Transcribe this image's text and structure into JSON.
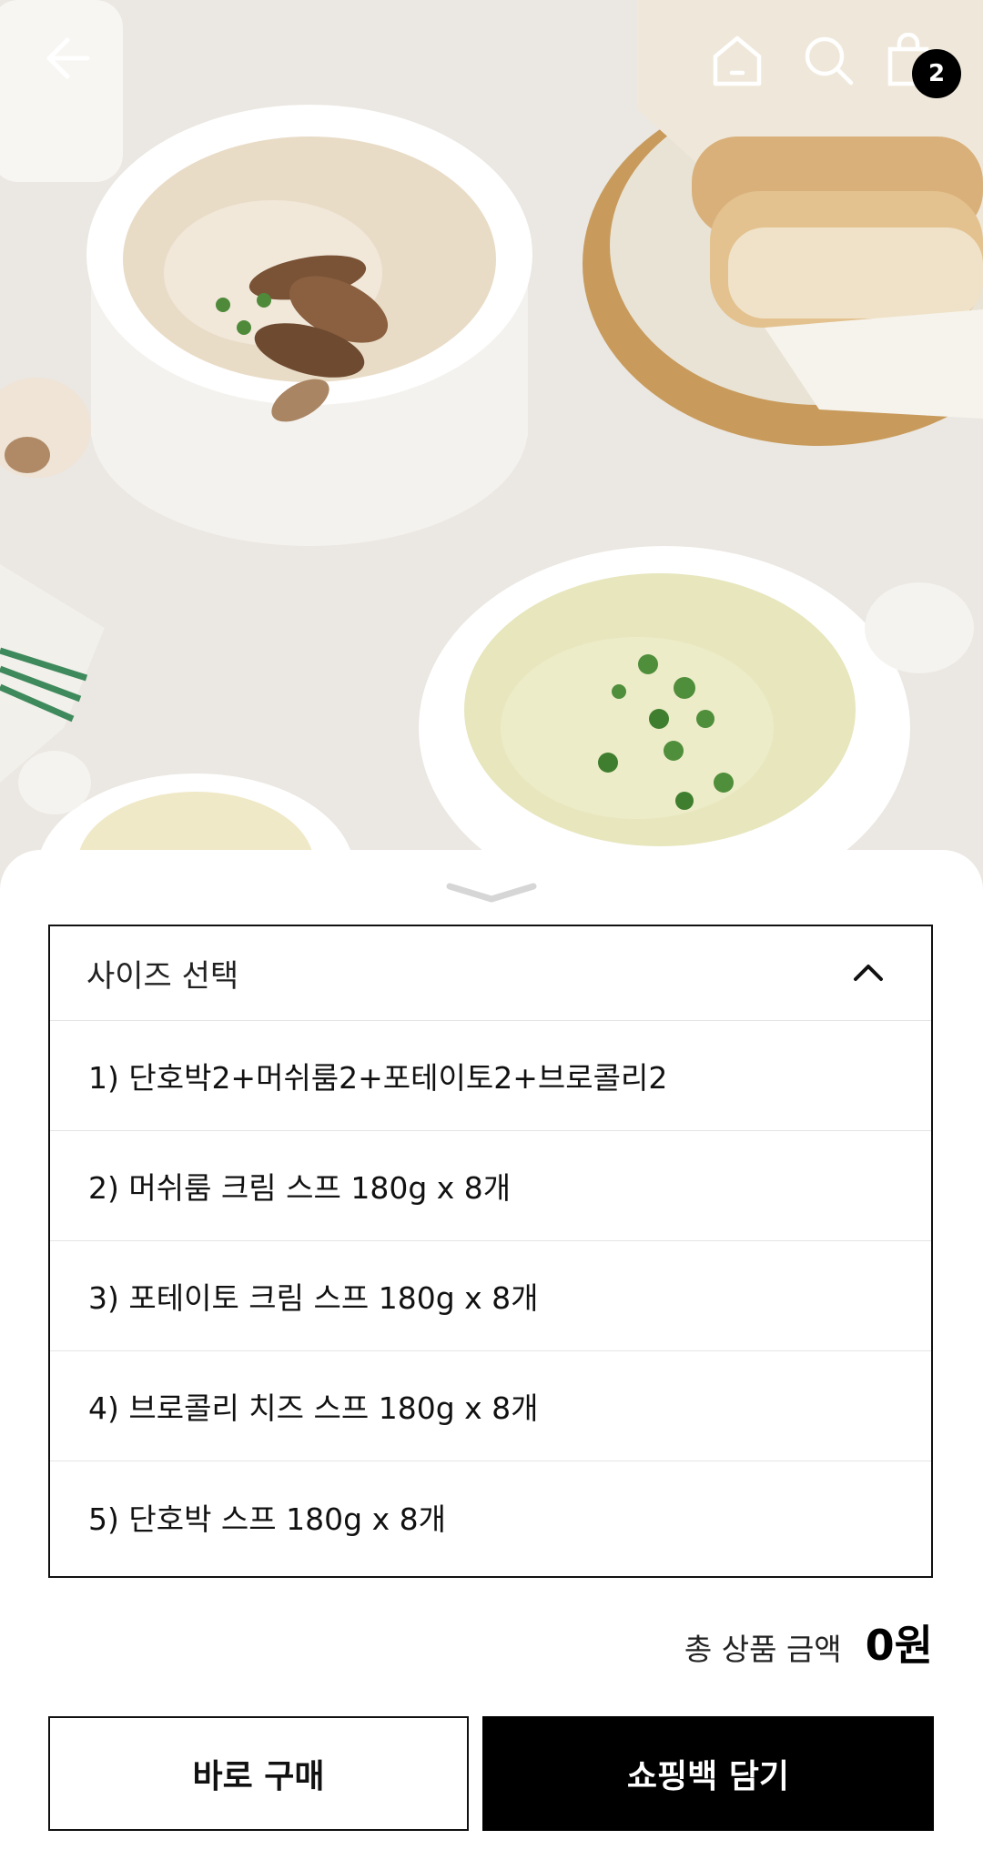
{
  "header": {
    "icons": [
      "back-arrow-icon",
      "home-icon",
      "search-icon",
      "shopping-bag-icon"
    ],
    "cart_count": "2"
  },
  "options_panel": {
    "select_label": "사이즈 선택",
    "options": [
      "1) 단호박2+머쉬룸2+포테이토2+브로콜리2",
      "2) 머쉬룸 크림 스프 180g x 8개",
      "3) 포테이토 크림 스프 180g x 8개",
      "4) 브로콜리 치즈 스프 180g x 8개",
      "5) 단호박 스프 180g x 8개"
    ]
  },
  "total": {
    "label": "총 상품 금액",
    "value": "0원"
  },
  "actions": {
    "buy_now": "바로 구매",
    "add_to_bag": "쇼핑백 담기"
  }
}
